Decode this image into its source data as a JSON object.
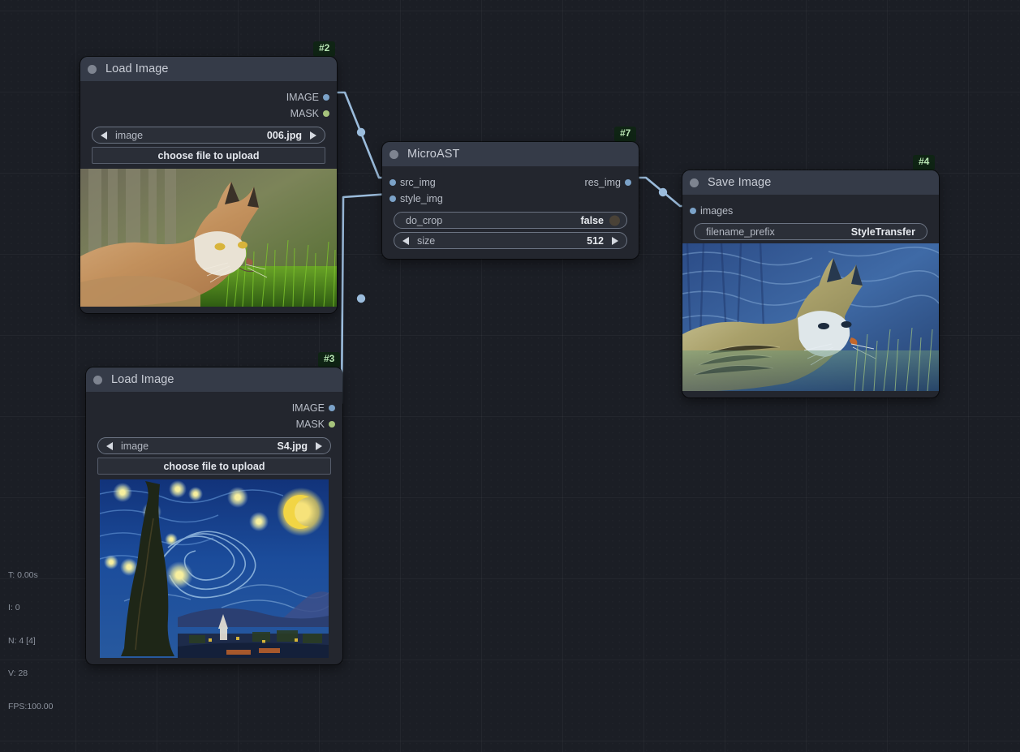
{
  "app": {
    "background_color": "#1b1e25",
    "grid_major_color": "#24282f",
    "link_color": "#9bbcdc"
  },
  "nodes": [
    {
      "id_badge": "#2",
      "title": "Load Image",
      "outputs": [
        {
          "label": "IMAGE",
          "type": "IMAGE",
          "color": "#7ba2c8"
        },
        {
          "label": "MASK",
          "type": "MASK",
          "color": "#a6c37c"
        }
      ],
      "inputs": [],
      "widgets": [
        {
          "kind": "combo",
          "label": "image",
          "value": "006.jpg"
        },
        {
          "kind": "button",
          "label": "choose file to upload"
        }
      ],
      "preview": "lynx-photo"
    },
    {
      "id_badge": "#7",
      "title": "MicroAST",
      "inputs": [
        {
          "label": "src_img",
          "type": "IMAGE",
          "color": "#7ba2c8"
        },
        {
          "label": "style_img",
          "type": "IMAGE",
          "color": "#7ba2c8"
        }
      ],
      "outputs": [
        {
          "label": "res_img",
          "type": "IMAGE",
          "color": "#7ba2c8"
        }
      ],
      "widgets": [
        {
          "kind": "toggle",
          "label": "do_crop",
          "value": "false"
        },
        {
          "kind": "number",
          "label": "size",
          "value": "512"
        }
      ],
      "preview": null
    },
    {
      "id_badge": "#4",
      "title": "Save Image",
      "inputs": [
        {
          "label": "images",
          "type": "IMAGE",
          "color": "#7ba2c8"
        }
      ],
      "outputs": [],
      "widgets": [
        {
          "kind": "text",
          "label": "filename_prefix",
          "value": "StyleTransfer"
        }
      ],
      "preview": "styled-lynx"
    },
    {
      "id_badge": "#3",
      "title": "Load Image",
      "outputs": [
        {
          "label": "IMAGE",
          "type": "IMAGE",
          "color": "#7ba2c8"
        },
        {
          "label": "MASK",
          "type": "MASK",
          "color": "#a6c37c"
        }
      ],
      "inputs": [],
      "widgets": [
        {
          "kind": "combo",
          "label": "image",
          "value": "S4.jpg"
        },
        {
          "kind": "button",
          "label": "choose file to upload"
        }
      ],
      "preview": "starry-night"
    }
  ],
  "stats": {
    "time": "T: 0.00s",
    "iterations": "I: 0",
    "nodes": "N: 4 [4]",
    "visible": "V: 28",
    "fps": "FPS:100.00"
  }
}
